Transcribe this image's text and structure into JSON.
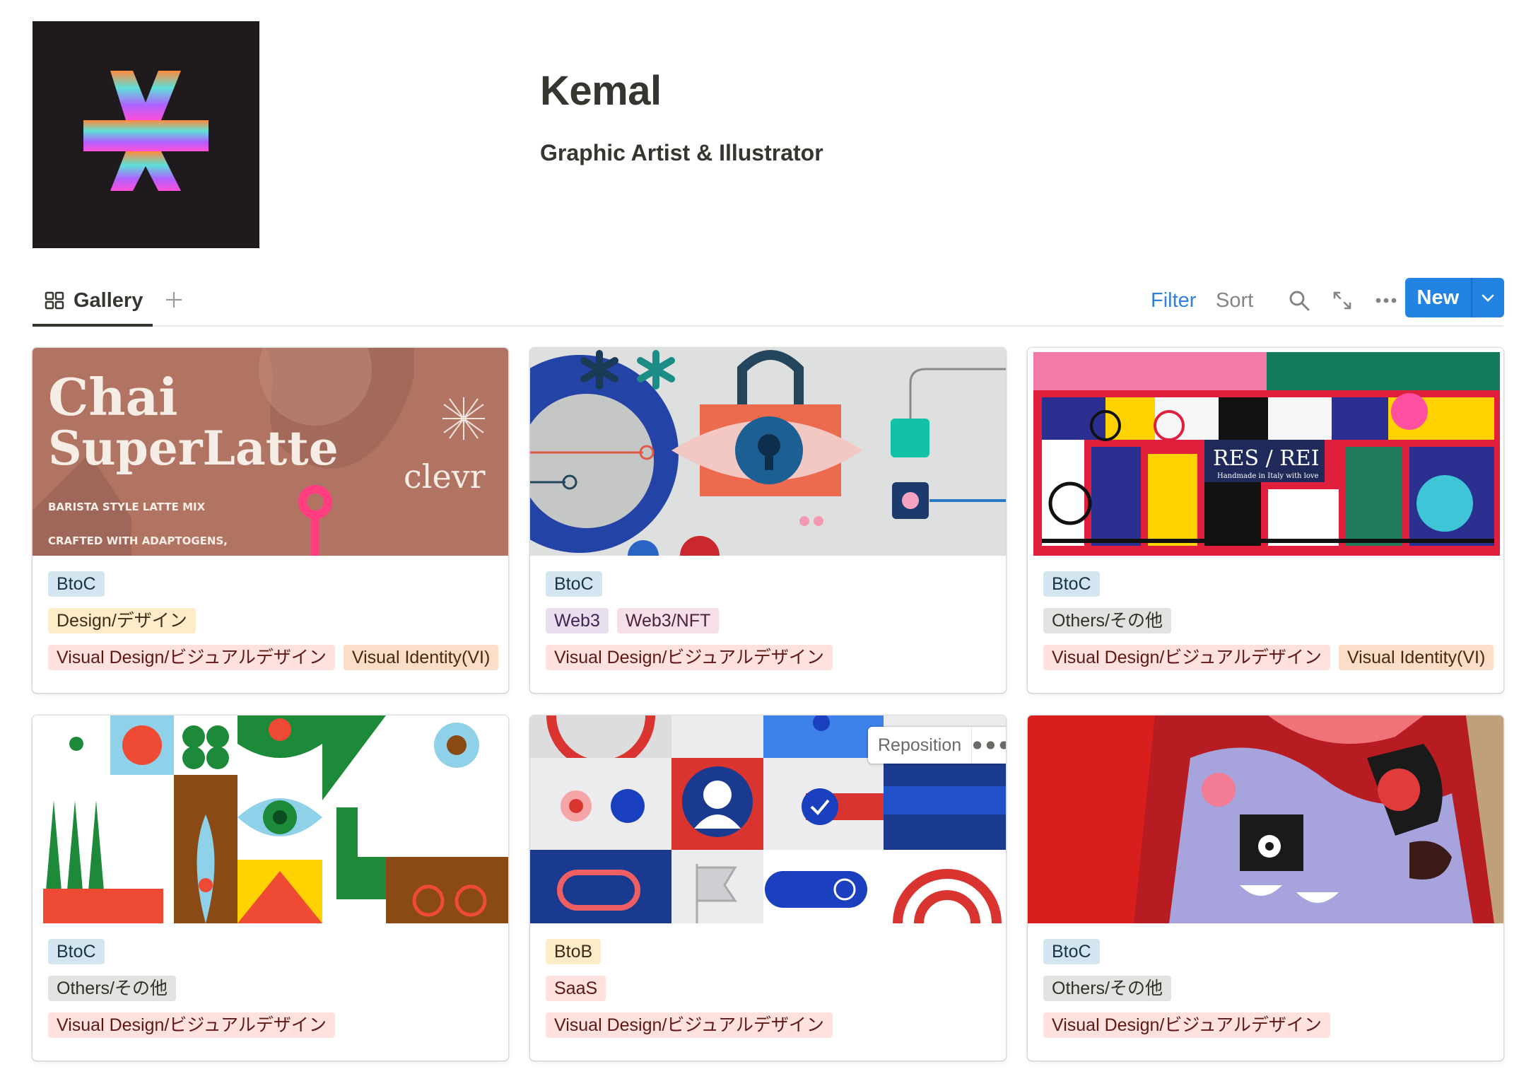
{
  "profile": {
    "name": "Kemal",
    "subtitle": "Graphic Artist & Illustrator"
  },
  "toolbar": {
    "view_label": "Gallery",
    "view_icon": "gallery-grid-icon",
    "add_view_icon": "plus-icon",
    "filter_label": "Filter",
    "sort_label": "Sort",
    "search_icon": "search-icon",
    "expand_icon": "expand-arrows-icon",
    "more_icon": "ellipsis-icon",
    "new_label": "New",
    "new_dropdown_icon": "chevron-down-icon"
  },
  "colors": {
    "accent": "#2383e2",
    "filter_text": "#2f82d8",
    "tag_blue": "#d3e5ef",
    "tag_yellow": "#fdecc8",
    "tag_red": "#ffe2dd",
    "tag_orange": "#fadec9",
    "tag_purple": "#e8deee",
    "tag_pink": "#f5e0e9",
    "tag_gray": "#e3e2e0"
  },
  "cards": [
    {
      "cover": {
        "title_line1": "Chai",
        "title_line2": "SuperLatte",
        "brand": "clevr",
        "tagline": "BARISTA STYLE LATTE MIX",
        "tagline2": "CRAFTED WITH ADAPTOGENS,"
      },
      "tags": [
        [
          {
            "label": "BtoC",
            "color": "blue"
          }
        ],
        [
          {
            "label": "Design/デザイン",
            "color": "yellow"
          }
        ],
        [
          {
            "label": "Visual Design/ビジュアルデザイン",
            "color": "red"
          },
          {
            "label": "Visual Identity(VI)",
            "color": "orange"
          }
        ]
      ]
    },
    {
      "cover": {},
      "tags": [
        [
          {
            "label": "BtoC",
            "color": "blue"
          }
        ],
        [
          {
            "label": "Web3",
            "color": "purple"
          },
          {
            "label": "Web3/NFT",
            "color": "pink"
          }
        ],
        [
          {
            "label": "Visual Design/ビジュアルデザイン",
            "color": "red"
          }
        ]
      ]
    },
    {
      "cover": {
        "sign_title": "RES / REI",
        "sign_subtitle": "Handmade in Italy with love"
      },
      "tags": [
        [
          {
            "label": "BtoC",
            "color": "blue"
          }
        ],
        [
          {
            "label": "Others/その他",
            "color": "gray"
          }
        ],
        [
          {
            "label": "Visual Design/ビジュアルデザイン",
            "color": "red"
          },
          {
            "label": "Visual Identity(VI)",
            "color": "orange"
          }
        ]
      ]
    },
    {
      "cover": {},
      "tags": [
        [
          {
            "label": "BtoC",
            "color": "blue"
          }
        ],
        [
          {
            "label": "Others/その他",
            "color": "gray"
          }
        ],
        [
          {
            "label": "Visual Design/ビジュアルデザイン",
            "color": "red"
          }
        ]
      ]
    },
    {
      "cover": {},
      "reposition_label": "Reposition",
      "tags": [
        [
          {
            "label": "BtoB",
            "color": "yellow"
          }
        ],
        [
          {
            "label": "SaaS",
            "color": "red"
          }
        ],
        [
          {
            "label": "Visual Design/ビジュアルデザイン",
            "color": "red"
          }
        ]
      ]
    },
    {
      "cover": {},
      "tags": [
        [
          {
            "label": "BtoC",
            "color": "blue"
          }
        ],
        [
          {
            "label": "Others/その他",
            "color": "gray"
          }
        ],
        [
          {
            "label": "Visual Design/ビジュアルデザイン",
            "color": "red"
          }
        ]
      ]
    }
  ]
}
